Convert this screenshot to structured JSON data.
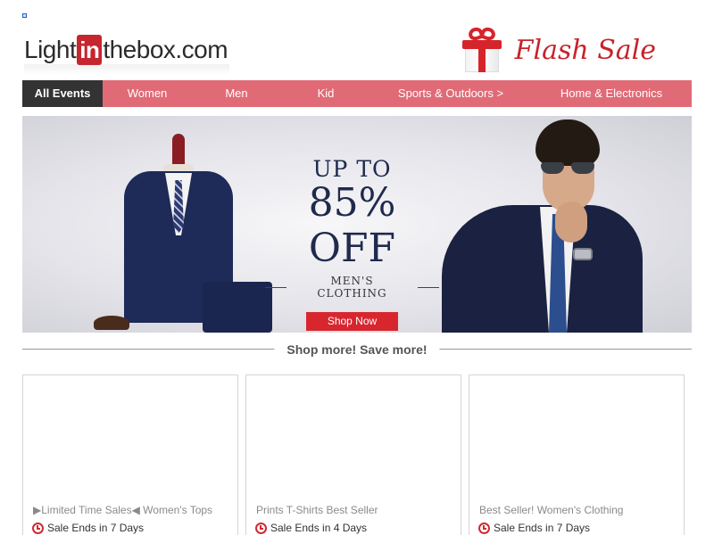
{
  "header": {
    "logo": {
      "part1": "Light",
      "part2": "in",
      "part3": "thebox",
      "part4": ".com"
    },
    "promo_title": "Flash Sale"
  },
  "nav": {
    "items": [
      {
        "label": "All Events",
        "active": true
      },
      {
        "label": "Women"
      },
      {
        "label": "Men"
      },
      {
        "label": "Kid"
      },
      {
        "label": "Sports & Outdoors >"
      },
      {
        "label": "Home & Electronics"
      }
    ]
  },
  "banner": {
    "line1": "UP TO",
    "line2": "85% OFF",
    "line3": "MEN'S CLOTHING",
    "button": "Shop Now"
  },
  "section": {
    "title": "Shop more! Save more!"
  },
  "cards": [
    {
      "title": "▶Limited Time Sales◀ Women's Tops",
      "sale": "Sale Ends in 7 Days"
    },
    {
      "title": "Prints T-Shirts Best Seller",
      "sale": "Sale Ends in 4 Days"
    },
    {
      "title": "Best Seller! Women's Clothing",
      "sale": "Sale Ends in 7 Days"
    }
  ],
  "colors": {
    "brand_red": "#c6262e",
    "nav_pink": "#e06b76",
    "nav_active": "#333333",
    "navy": "#1f2a4d"
  }
}
